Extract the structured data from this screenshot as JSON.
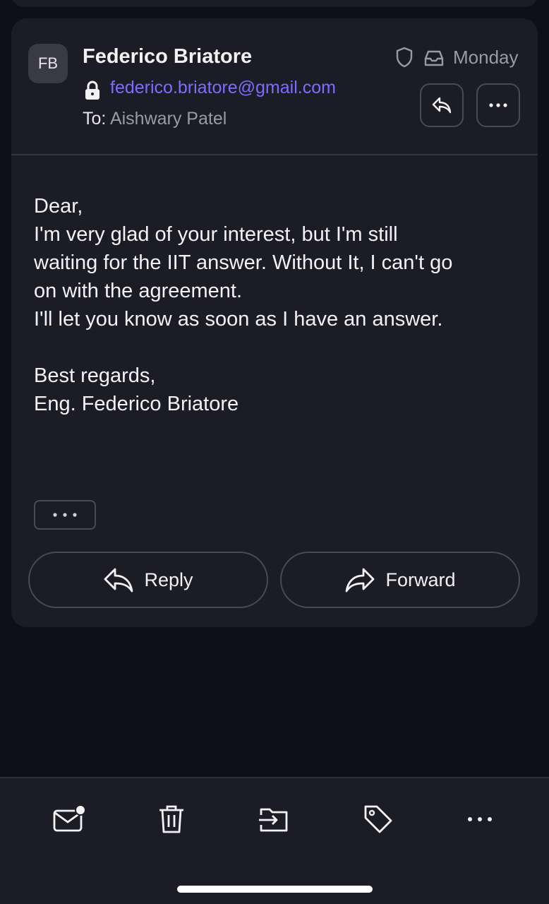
{
  "message": {
    "avatar_initials": "FB",
    "sender_name": "Federico Briatore",
    "sender_email": "federico.briatore@gmail.com",
    "to_label": "To:",
    "recipient": "Aishwary Patel",
    "date": "Monday",
    "body_lines": [
      "Dear,",
      "I'm very glad of your interest, but I'm still",
      "waiting for the IIT answer. Without It, I can't go",
      "on with the agreement.",
      "I'll let you know as soon as I have an answer.",
      "",
      "Best regards,",
      "Eng. Federico Briatore"
    ]
  },
  "actions": {
    "reply_label": "Reply",
    "forward_label": "Forward"
  },
  "toolbar": {
    "items": [
      "mark-unread-icon",
      "trash-icon",
      "move-to-folder-icon",
      "label-tag-icon",
      "more-horizontal-icon"
    ]
  },
  "colors": {
    "background": "#0f0f1a",
    "card": "#1c1c26",
    "accent_link": "#7d6dff",
    "muted_text": "#9a9aa6"
  }
}
